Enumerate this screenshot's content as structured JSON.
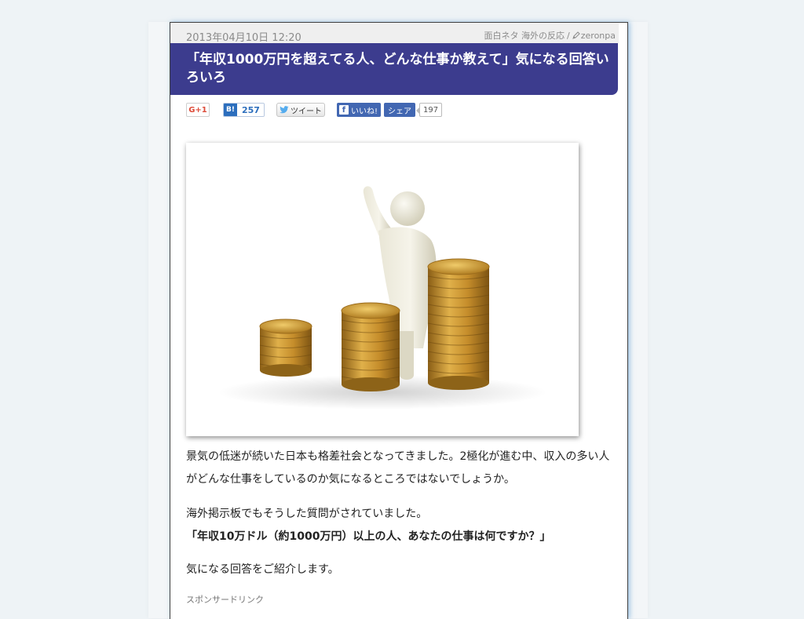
{
  "meta": {
    "date": "2013年04月10日 12:20",
    "category": "面白ネタ 海外の反応",
    "separator": "/",
    "author": "zeronpa"
  },
  "article": {
    "title": "「年収1000万円を超えてる人、どんな仕事か教えて」気になる回答いろいろ",
    "paragraph1": "景気の低迷が続いた日本も格差社会となってきました。2極化が進む中、収入の多い人がどんな仕事をしているのか気になるところではないでしょうか。",
    "paragraph2": "海外掲示板でもそうした質問がされていました。",
    "quote": "「年収10万ドル（約1000万円）以上の人、あなたの仕事は何ですか？」",
    "paragraph3": "気になる回答をご紹介します。",
    "sponsor_label": "スポンサードリンク"
  },
  "social": {
    "gplus_label": "G+1",
    "hatena_logo": "B!",
    "hatena_count": "257",
    "tweet_label": "ツイート",
    "fb_like_label": "いいね!",
    "fb_share_label": "シェア",
    "fb_count": "197"
  },
  "colors": {
    "title_bg": "#3c3c8e",
    "hatena_blue": "#2c6ebd",
    "facebook_blue": "#4267b2",
    "gplus_red": "#dd4b39",
    "coin_gold": "#c9962f"
  },
  "icons": [
    "pencil-icon",
    "twitter-bird-icon",
    "facebook-icon"
  ]
}
